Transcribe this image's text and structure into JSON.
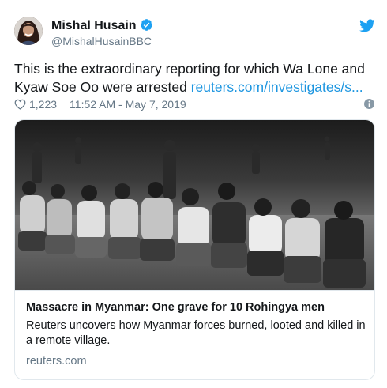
{
  "author": {
    "name": "Mishal Husain",
    "handle": "@MishalHusainBBC",
    "verified": true
  },
  "tweet": {
    "text": "This is the extraordinary reporting for which Wa Lone and Kyaw Soe Oo were arrested ",
    "link": "reuters.com/investigates/s...",
    "likes": "1,223",
    "timestamp": "11:52 AM - May 7, 2019"
  },
  "card": {
    "title": "Massacre in Myanmar: One grave for 10 Rohingya men",
    "description": "Reuters uncovers how Myanmar forces burned, looted and killed in a remote village.",
    "domain": "reuters.com"
  },
  "icons": {
    "verified": "verified-badge-icon",
    "bird": "twitter-bird-icon",
    "heart": "heart-icon",
    "info": "info-icon"
  },
  "colors": {
    "accent": "#1da1f2",
    "link": "#1b95e0",
    "secondary_text": "#657786",
    "border": "#e1e8ed"
  }
}
